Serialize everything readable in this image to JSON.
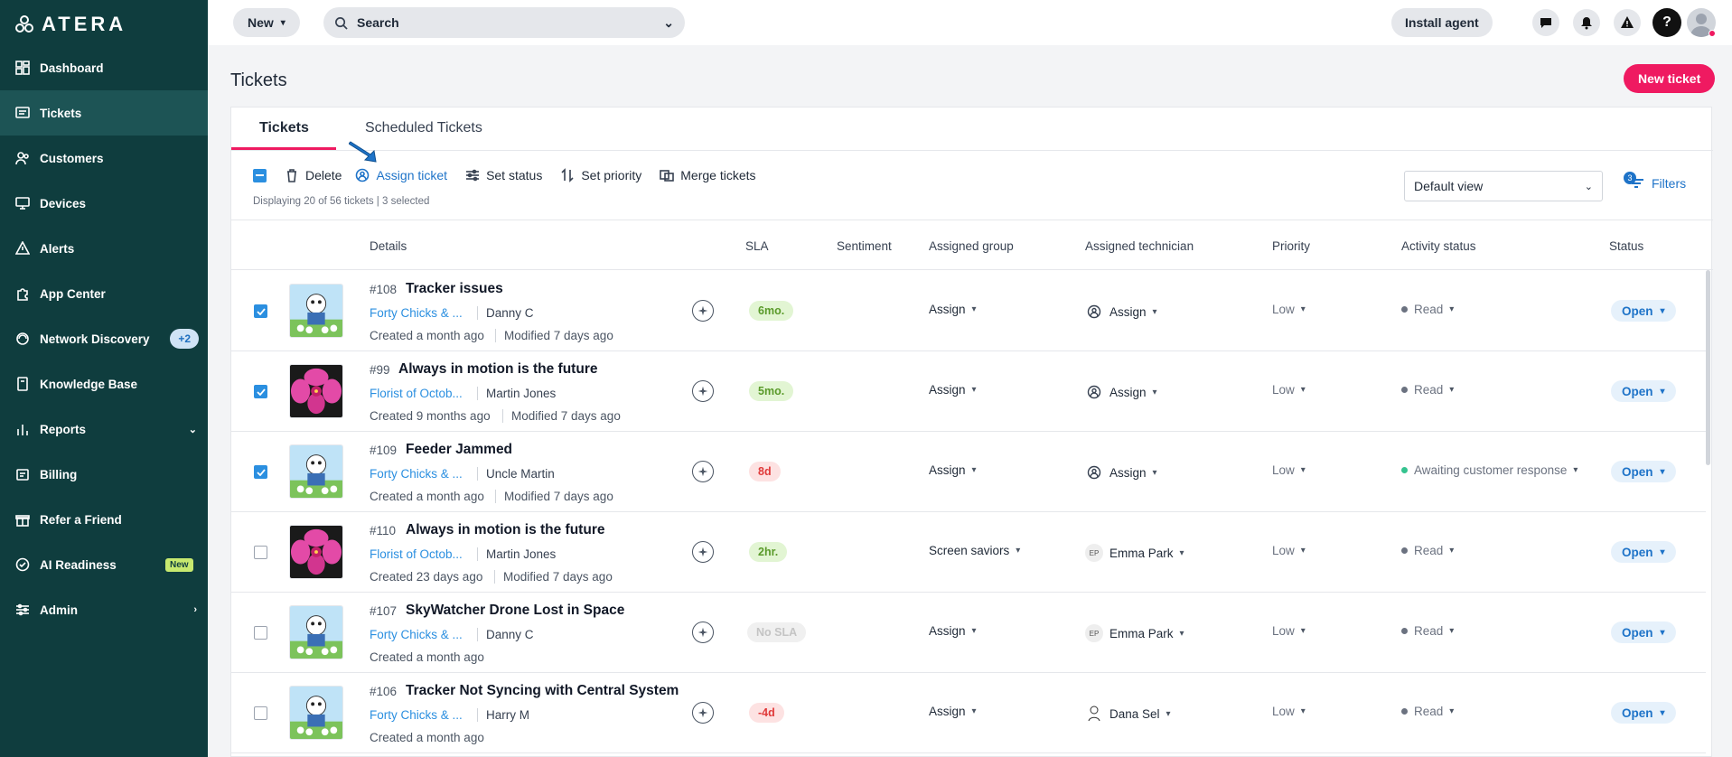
{
  "brand": "ATERA",
  "sidebar": {
    "items": [
      {
        "label": "Dashboard",
        "icon": "dashboard-icon"
      },
      {
        "label": "Tickets",
        "icon": "tickets-icon",
        "active": true
      },
      {
        "label": "Customers",
        "icon": "customers-icon"
      },
      {
        "label": "Devices",
        "icon": "devices-icon"
      },
      {
        "label": "Alerts",
        "icon": "alerts-icon"
      },
      {
        "label": "App Center",
        "icon": "app-center-icon"
      },
      {
        "label": "Network Discovery",
        "icon": "network-icon",
        "badge": "+2"
      },
      {
        "label": "Knowledge Base",
        "icon": "knowledge-icon"
      },
      {
        "label": "Reports",
        "icon": "reports-icon"
      },
      {
        "label": "Billing",
        "icon": "billing-icon"
      },
      {
        "label": "Refer a Friend",
        "icon": "gift-icon"
      },
      {
        "label": "AI Readiness",
        "icon": "ai-readiness-icon",
        "badge": "New"
      },
      {
        "label": "Admin",
        "icon": "admin-icon"
      }
    ]
  },
  "topbar": {
    "new_label": "New",
    "search_label": "Search",
    "install_label": "Install agent"
  },
  "page": {
    "title": "Tickets",
    "new_ticket_label": "New ticket"
  },
  "tabs": [
    "Tickets",
    "Scheduled Tickets"
  ],
  "actions": {
    "delete": "Delete",
    "assign": "Assign ticket",
    "set_status": "Set status",
    "set_priority": "Set priority",
    "merge": "Merge tickets"
  },
  "displaying": "Displaying 20 of 56 tickets | 3 selected",
  "view": {
    "selected": "Default view"
  },
  "filters": {
    "label": "Filters",
    "count": "3"
  },
  "columns": {
    "details": "Details",
    "sla": "SLA",
    "sentiment": "Sentiment",
    "group": "Assigned group",
    "technician": "Assigned technician",
    "priority": "Priority",
    "activity": "Activity status",
    "status": "Status"
  },
  "rows": [
    {
      "checked": true,
      "thumb": "cow",
      "num": "#108",
      "title": "Tracker issues",
      "customer": "Forty Chicks & ...",
      "contact": "Danny C",
      "created": "Created a month ago",
      "modified": "Modified 7 days ago",
      "sla": "6mo.",
      "sla_type": "green",
      "group": "Assign",
      "tech": "Assign",
      "tech_type": "icon",
      "priority": "Low",
      "activity": "Read",
      "activity_color": "#6b7280",
      "status": "Open"
    },
    {
      "checked": true,
      "thumb": "orchid",
      "num": "#99",
      "title": "Always in motion is the future",
      "customer": "Florist of Octob...",
      "contact": "Martin Jones",
      "created": "Created 9 months ago",
      "modified": "Modified 7 days ago",
      "sla": "5mo.",
      "sla_type": "green",
      "group": "Assign",
      "tech": "Assign",
      "tech_type": "icon",
      "priority": "Low",
      "activity": "Read",
      "activity_color": "#6b7280",
      "status": "Open"
    },
    {
      "checked": true,
      "thumb": "cow",
      "num": "#109",
      "title": "Feeder Jammed",
      "customer": "Forty Chicks & ...",
      "contact": "Uncle Martin",
      "created": "Created a month ago",
      "modified": "Modified 7 days ago",
      "sla": "8d",
      "sla_type": "red",
      "group": "Assign",
      "tech": "Assign",
      "tech_type": "icon",
      "priority": "Low",
      "activity": "Awaiting customer response",
      "activity_color": "#34c38f",
      "status": "Open"
    },
    {
      "checked": false,
      "thumb": "orchid",
      "num": "#110",
      "title": "Always in motion is the future",
      "customer": "Florist of Octob...",
      "contact": "Martin Jones",
      "created": "Created 23 days ago",
      "modified": "Modified 7 days ago",
      "sla": "2hr.",
      "sla_type": "green",
      "group": "Screen saviors",
      "tech": "Emma Park",
      "tech_type": "EP",
      "priority": "Low",
      "activity": "Read",
      "activity_color": "#6b7280",
      "status": "Open"
    },
    {
      "checked": false,
      "thumb": "cow",
      "num": "#107",
      "title": "SkyWatcher Drone Lost in Space",
      "customer": "Forty Chicks & ...",
      "contact": "Danny C",
      "created": "Created a month ago",
      "modified": "",
      "sla": "No SLA",
      "sla_type": "grey",
      "group": "Assign",
      "tech": "Emma Park",
      "tech_type": "EP",
      "priority": "Low",
      "activity": "Read",
      "activity_color": "#6b7280",
      "status": "Open"
    },
    {
      "checked": false,
      "thumb": "cow",
      "num": "#106",
      "title": "Tracker Not Syncing with Central System",
      "customer": "Forty Chicks & ...",
      "contact": "Harry M",
      "created": "Created a month ago",
      "modified": "",
      "sla": "-4d",
      "sla_type": "red",
      "group": "Assign",
      "tech": "Dana Sel",
      "tech_type": "sketch",
      "priority": "Low",
      "activity": "Read",
      "activity_color": "#6b7280",
      "status": "Open"
    }
  ]
}
